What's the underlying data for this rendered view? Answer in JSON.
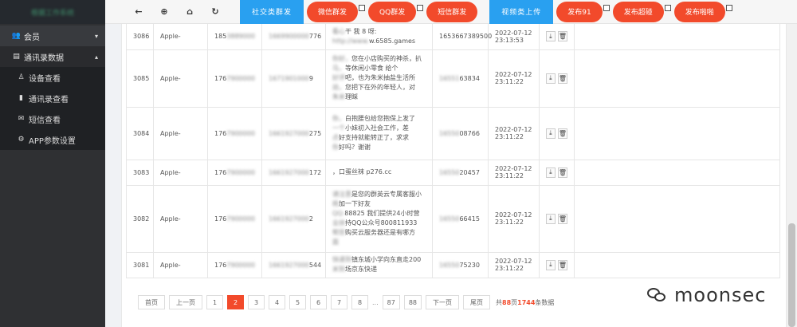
{
  "sidebar": {
    "brand": "根据工作系统",
    "items": [
      {
        "icon": "users-icon",
        "glyph": "👥",
        "label": "会员",
        "caret": "▾"
      },
      {
        "icon": "id-card-icon",
        "glyph": "▤",
        "label": "通讯录数据",
        "caret": "▴"
      }
    ],
    "subitems": [
      {
        "icon": "user-icon",
        "glyph": "♙",
        "label": "设备查看"
      },
      {
        "icon": "book-icon",
        "glyph": "▮",
        "label": "通讯录查看"
      },
      {
        "icon": "envelope-icon",
        "glyph": "✉",
        "label": "短信查看"
      },
      {
        "icon": "gear-icon",
        "glyph": "⚙",
        "label": "APP参数设置"
      }
    ]
  },
  "toolbar": {
    "icons": [
      {
        "name": "back-arrow-icon",
        "glyph": "←"
      },
      {
        "name": "target-icon",
        "glyph": "⊕"
      },
      {
        "name": "bank-icon",
        "glyph": "⌂"
      },
      {
        "name": "refresh-icon",
        "glyph": "↻"
      }
    ],
    "social_button": "社交类群发",
    "wechat_button": "微信群发",
    "qq_button": "QQ群发",
    "sms_button": "短信群发",
    "video_button": "视频类上传",
    "publish91_button": "发布91",
    "publish_dy_button": "发布超碰",
    "publish_aph_button": "发布啪啪"
  },
  "table": {
    "rows": [
      {
        "id": "3086",
        "model": "Apple-",
        "phone_visible": "185",
        "phone_blur": "3889000",
        "imei_blur": "1669900000",
        "imei_tail": "776",
        "msg_lines": [
          {
            "blur": "看心",
            "text": "干 我 8 呀:"
          },
          {
            "blur": "http://www.",
            "text": "w.6585.games"
          }
        ],
        "sender": "1653667389500",
        "sender_blur": "",
        "date": "2022-07-12",
        "time": "23:13:53"
      },
      {
        "id": "3085",
        "model": "Apple-",
        "phone_visible": "176",
        "phone_blur": "7900000",
        "imei_blur": "1671901000",
        "imei_tail": "9",
        "msg_lines": [
          {
            "blur": "你好，",
            "text": "您在小店购买的神杀，扒"
          },
          {
            "blur": "马，",
            "text": "等休闲小零食 给个"
          },
          {
            "blur": "好评",
            "text": "吧，也为朱米抽盐生活所"
          },
          {
            "blur": "迫，",
            "text": "您把下在外的年轻人，对"
          },
          {
            "blur": "朱米",
            "text": "理睬"
          }
        ],
        "sender": "",
        "sender_blur": "16551",
        "sender_tail": "63834",
        "date": "2022-07-12",
        "time": "23:11:22"
      },
      {
        "id": "3084",
        "model": "Apple-",
        "phone_visible": "176",
        "phone_blur": "7900000",
        "imei_blur": "1661927000",
        "imei_tail": "275",
        "msg_lines": [
          {
            "blur": "你，",
            "text": "白抱腰包给您抱保上发了"
          },
          {
            "blur": "一个",
            "text": "小妹初入社会工作，差"
          },
          {
            "blur": "点",
            "text": "好支持就能转正了，求求"
          },
          {
            "blur": "你",
            "text": "好吗？谢谢"
          }
        ],
        "sender": "",
        "sender_blur": "16550",
        "sender_tail": "08766",
        "date": "2022-07-12",
        "time": "23:11:22"
      },
      {
        "id": "3083",
        "model": "Apple-",
        "phone_visible": "176",
        "phone_blur": "7900000",
        "imei_blur": "1661927000",
        "imei_tail": "172",
        "msg_lines": [
          {
            "blur": "",
            "text": "，口蛋丝袜 p276.cc"
          }
        ],
        "sender": "",
        "sender_blur": "16550",
        "sender_tail": "20457",
        "date": "2022-07-12",
        "time": "23:11:22"
      },
      {
        "id": "3082",
        "model": "Apple-",
        "phone_visible": "176",
        "phone_blur": "7900000",
        "imei_blur": "1661927000",
        "imei_tail": "2",
        "msg_lines": [
          {
            "blur": "请注意",
            "text": "是您的群英云专属客服小"
          },
          {
            "blur": "杨",
            "text": "加一下好友"
          },
          {
            "blur": "QQ:",
            "text": "88825 我们提供24小时营"
          },
          {
            "blur": "业扶",
            "text": "持QQ公众号800811933"
          },
          {
            "blur": "帮您",
            "text": "购买云服务器还是有哪方"
          },
          {
            "blur": "面",
            "text": ""
          }
        ],
        "sender": "",
        "sender_blur": "16550",
        "sender_tail": "66415",
        "date": "2022-07-12",
        "time": "23:11:22"
      },
      {
        "id": "3081",
        "model": "Apple-",
        "phone_visible": "176",
        "phone_blur": "7900000",
        "imei_blur": "1661927000",
        "imei_tail": "544",
        "msg_lines": [
          {
            "blur": "快递到",
            "text": "镇东城小学向东直走200"
          },
          {
            "blur": "米到",
            "text": "场京东快递"
          }
        ],
        "sender": "",
        "sender_blur": "16550",
        "sender_tail": "75230",
        "date": "2022-07-12",
        "time": "23:11:22"
      }
    ],
    "download_glyph": "⤓",
    "delete_glyph": "🗑"
  },
  "pagination": {
    "first": "首页",
    "prev": "上一页",
    "pages": [
      "1",
      "2",
      "3",
      "4",
      "5",
      "6",
      "7",
      "8"
    ],
    "current": "2",
    "dots": "...",
    "tail_pages": [
      "87",
      "88"
    ],
    "next": "下一页",
    "last": "尾页",
    "info_prefix": "共",
    "total_pages": "88",
    "info_mid": "页",
    "total_records": "1744",
    "info_suffix": "条数据"
  },
  "watermark": {
    "text": "moonsec"
  },
  "colors": {
    "accent_red": "#f24a2b",
    "accent_blue": "#29a0f0",
    "sidebar_bg": "#2f3033"
  }
}
